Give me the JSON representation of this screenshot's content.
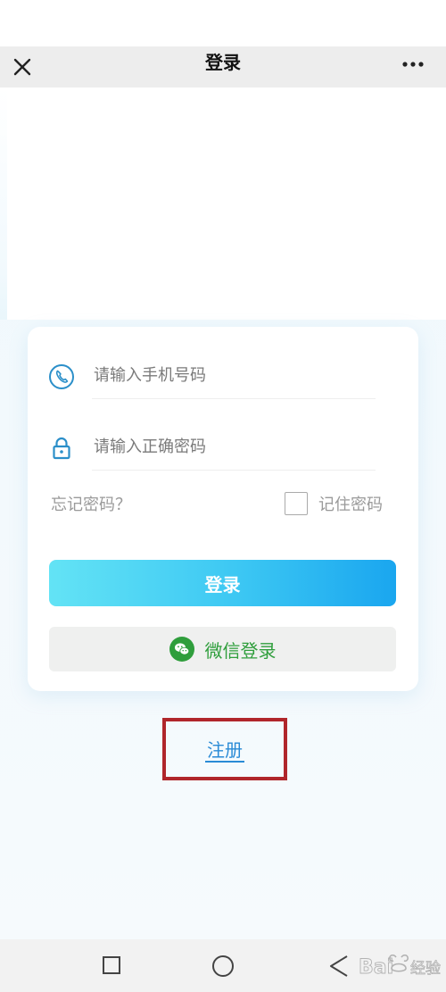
{
  "header": {
    "title": "登录",
    "close_icon": "close-icon",
    "more_icon": "more-dots-icon"
  },
  "form": {
    "phone": {
      "placeholder": "请输入手机号码",
      "value": "",
      "icon": "phone-icon"
    },
    "password": {
      "placeholder": "请输入正确密码",
      "value": "",
      "icon": "lock-icon"
    },
    "forgot_label": "忘记密码？",
    "remember": {
      "label": "记住密码",
      "checked": false
    },
    "login_label": "登录",
    "wechat_label": "微信登录",
    "wechat_icon": "wechat-icon"
  },
  "register_label": "注册",
  "nav": {
    "recents_icon": "square-icon",
    "home_icon": "circle-icon",
    "back_icon": "back-triangle-icon"
  },
  "watermark": {
    "text": "Bai经验"
  },
  "colors": {
    "accent_blue": "#1aa6ef",
    "accent_cyan": "#63e3f5",
    "icon_blue": "#2b8fc9",
    "wechat_green": "#2f9e3c",
    "link_blue": "#2a8bd6",
    "highlight_red": "#b0262b"
  }
}
